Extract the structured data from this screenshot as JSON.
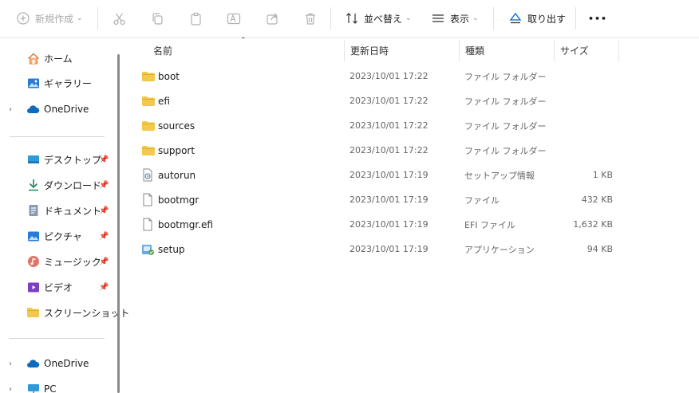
{
  "toolbar": {
    "new_label": "新規作成",
    "sort_label": "並べ替え",
    "view_label": "表示",
    "eject_label": "取り出す",
    "more_label": "•••"
  },
  "nav": {
    "home": "ホーム",
    "gallery": "ギャラリー",
    "onedrive1": "OneDrive",
    "desktop": "デスクトップ",
    "downloads": "ダウンロード",
    "documents": "ドキュメント",
    "pictures": "ピクチャ",
    "music": "ミュージック",
    "videos": "ビデオ",
    "screenshots": "スクリーンショット",
    "onedrive2": "OneDrive",
    "pc": "PC"
  },
  "columns": {
    "name": "名前",
    "date": "更新日時",
    "type": "種類",
    "size": "サイズ"
  },
  "files": [
    {
      "name": "boot",
      "date": "2023/10/01 17:22",
      "type": "ファイル フォルダー",
      "size": "",
      "icon": "folder-icon"
    },
    {
      "name": "efi",
      "date": "2023/10/01 17:22",
      "type": "ファイル フォルダー",
      "size": "",
      "icon": "folder-icon"
    },
    {
      "name": "sources",
      "date": "2023/10/01 17:22",
      "type": "ファイル フォルダー",
      "size": "",
      "icon": "folder-icon"
    },
    {
      "name": "support",
      "date": "2023/10/01 17:22",
      "type": "ファイル フォルダー",
      "size": "",
      "icon": "folder-icon"
    },
    {
      "name": "autorun",
      "date": "2023/10/01 17:19",
      "type": "セットアップ情報",
      "size": "1 KB",
      "icon": "setup-info-file-icon"
    },
    {
      "name": "bootmgr",
      "date": "2023/10/01 17:19",
      "type": "ファイル",
      "size": "432 KB",
      "icon": "file-icon"
    },
    {
      "name": "bootmgr.efi",
      "date": "2023/10/01 17:19",
      "type": "EFI ファイル",
      "size": "1,632 KB",
      "icon": "file-icon"
    },
    {
      "name": "setup",
      "date": "2023/10/01 17:19",
      "type": "アプリケーション",
      "size": "94 KB",
      "icon": "setup-app-icon"
    }
  ],
  "colors": {
    "folder": "#f2c94c",
    "accent": "#0067c0"
  }
}
